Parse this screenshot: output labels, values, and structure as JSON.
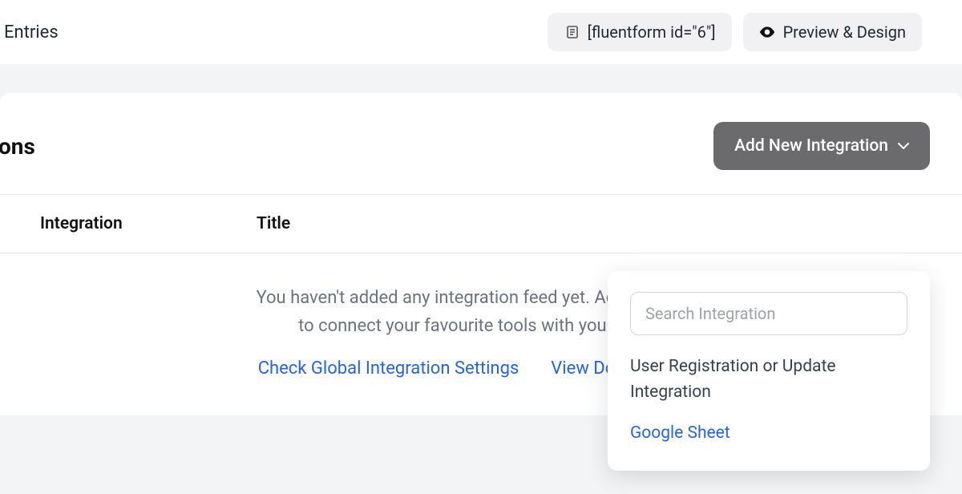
{
  "topbar": {
    "tab_label": "Entries",
    "shortcode": "[fluentform id=\"6\"]",
    "preview_label": "Preview & Design"
  },
  "panel": {
    "title_fragment": "ons",
    "add_button": "Add New Integration"
  },
  "table": {
    "col_integration": "Integration",
    "col_title": "Title"
  },
  "empty": {
    "line1": "You haven't added any integration feed yet. Add new integ",
    "line2": "to connect your favourite tools with your forms",
    "link_settings": "Check Global Integration Settings",
    "link_docs": "View Documentatio"
  },
  "dropdown": {
    "placeholder": "Search Integration",
    "item1": "User Registration or Update Integration",
    "item2": "Google Sheet"
  }
}
